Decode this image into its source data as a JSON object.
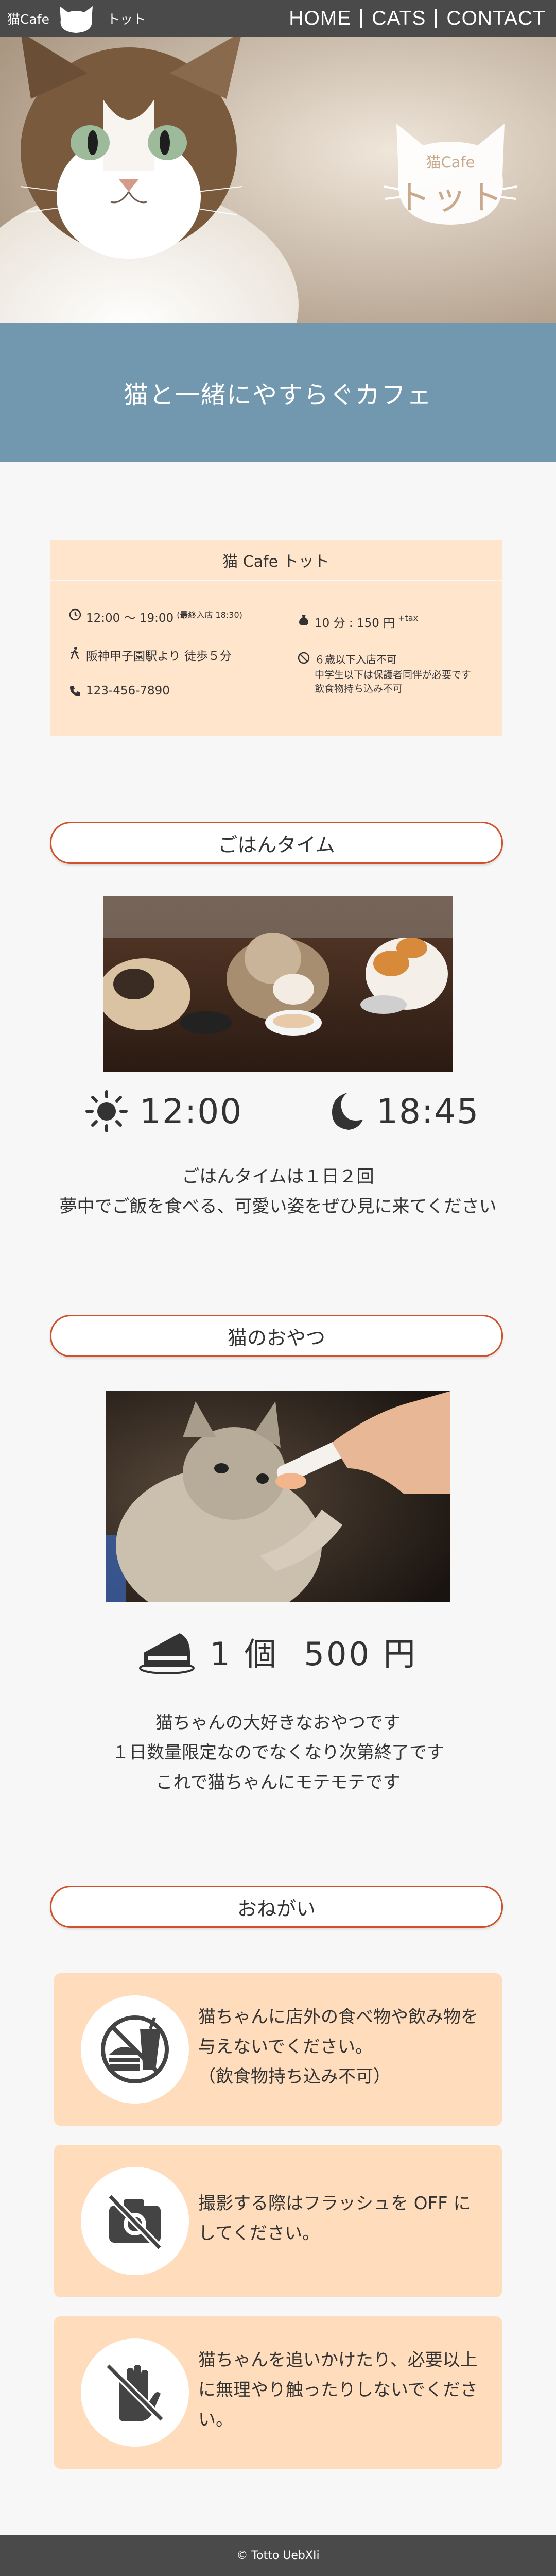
{
  "header": {
    "brand": "猫Cafe",
    "brand_sub": "トット",
    "nav": [
      "HOME",
      "CATS",
      "CONTACT"
    ]
  },
  "hero": {
    "badge_small": "猫Cafe",
    "badge_big": "トット",
    "tagline": "猫と一緒にやすらぐカフェ"
  },
  "info": {
    "title": "猫 Cafe トット",
    "hours": "12:00 ～ 19:00",
    "hours_note": "(最終入店 18:30)",
    "access": "阪神甲子園駅より 徒歩５分",
    "phone": "123-456-7890",
    "price": "10 分 : 150 円",
    "price_note": "+tax",
    "rule1": "６歳以下入店不可",
    "rule2": "中学生以下は保護者同伴が必要です",
    "rule3": "飲食物持ち込み不可"
  },
  "meal": {
    "heading": "ごはんタイム",
    "time1": "12:00",
    "time2": "18:45",
    "line1": "ごはんタイムは１日２回",
    "line2": "夢中でご飯を食べる、可愛い姿をぜひ見に来てください"
  },
  "snack": {
    "heading": "猫のおやつ",
    "qty": "1 個",
    "price": "500 円",
    "line1": "猫ちゃんの大好きなおやつです",
    "line2": "１日数量限定なのでなくなり次第終了です",
    "line3": "これで猫ちゃんにモテモテです"
  },
  "requests": {
    "heading": "おねがい",
    "items": [
      {
        "icon": "no-food-icon",
        "lines": [
          "猫ちゃんに店外の食べ物や飲み物を",
          "与えないでください。",
          "（飲食物持ち込み不可）"
        ]
      },
      {
        "icon": "no-camera-flash-icon",
        "lines": [
          "撮影する際はフラッシュを OFF に",
          "してください。"
        ]
      },
      {
        "icon": "no-touch-icon",
        "lines": [
          "猫ちゃんを追いかけたり、必要以上",
          "に無理やり触ったりしないでくださ",
          "い。"
        ]
      }
    ]
  },
  "footer": {
    "copyright": "© Totto UebXIi"
  },
  "colors": {
    "header_bg": "#4a4a4a",
    "tagline_bg": "#7198ae",
    "info_bg": "#ffe5cc",
    "card_bg": "#ffdcbc",
    "accent_border": "#d0502a"
  }
}
